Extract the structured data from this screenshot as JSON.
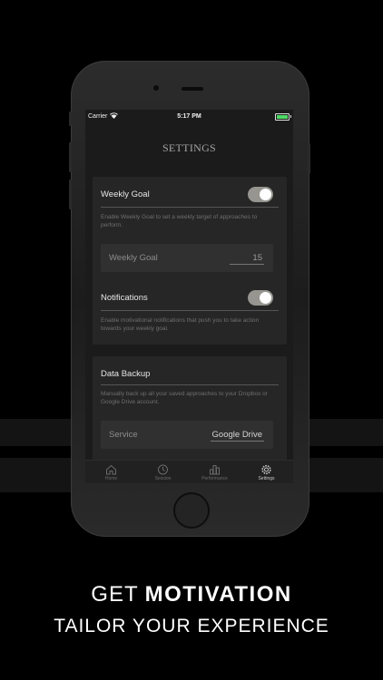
{
  "status_bar": {
    "carrier": "Carrier",
    "time": "5:17 PM"
  },
  "header": {
    "title": "SETTINGS"
  },
  "weekly_goal": {
    "label": "Weekly Goal",
    "toggle_on": true,
    "description": "Enable Weekly Goal to set a weekly target of approaches to perform.",
    "field_label": "Weekly Goal",
    "field_value": "15"
  },
  "notifications": {
    "label": "Notifications",
    "toggle_on": true,
    "description": "Enable motivational notifications that push you to take action towards your weekly goal."
  },
  "data_backup": {
    "label": "Data Backup",
    "description": "Manually back up all your saved approaches to your Dropbox or Google Drive account.",
    "service_label": "Service",
    "service_value": "Google Drive"
  },
  "tab_bar": {
    "tabs": [
      {
        "label": "Home",
        "icon": "home-icon",
        "active": false
      },
      {
        "label": "Session",
        "icon": "timer-icon",
        "active": false
      },
      {
        "label": "Performance",
        "icon": "bar-chart-icon",
        "active": false
      },
      {
        "label": "Settings",
        "icon": "gear-icon",
        "active": true
      }
    ]
  },
  "promo": {
    "line1_light": "GET",
    "line1_bold": "MOTIVATION",
    "line2": "TAILOR YOUR EXPERIENCE"
  },
  "colors": {
    "background": "#000000",
    "screen_bg": "#1b1b1b",
    "card_bg": "#262626",
    "toggle_on": "#969590",
    "battery": "#4cd964"
  }
}
